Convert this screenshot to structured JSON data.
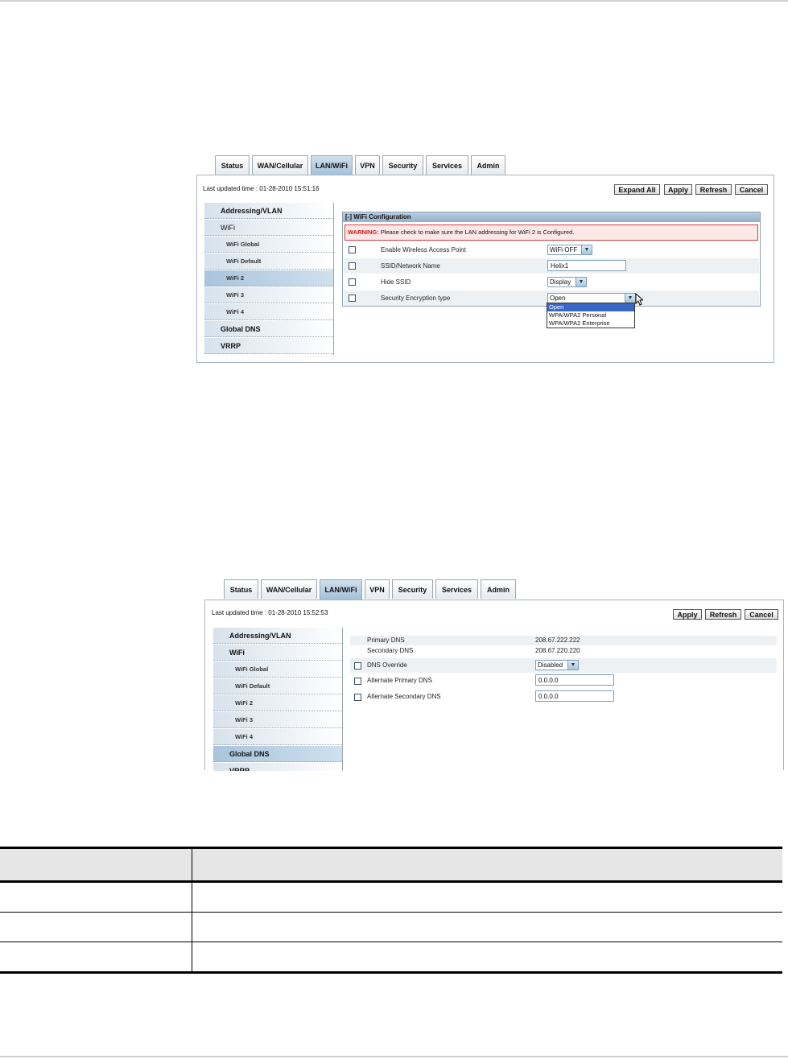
{
  "shot1": {
    "tabs": [
      "Status",
      "WAN/Cellular",
      "LAN/WiFi",
      "VPN",
      "Security",
      "Services",
      "Admin"
    ],
    "active_tab": "LAN/WiFi",
    "last_updated": "Last updated time : 01-28-2010 15:51:16",
    "buttons": {
      "expand_all": "Expand All",
      "apply": "Apply",
      "refresh": "Refresh",
      "cancel": "Cancel"
    },
    "sidebar": [
      "Addressing/VLAN",
      "WiFi",
      "WiFi Global",
      "WiFi Default",
      "WiFi 2",
      "WiFi 3",
      "WiFi 4",
      "Global DNS",
      "VRRP"
    ],
    "selected_item": "WiFi 2",
    "config_title": "[-] WiFi Configuration",
    "warning_label": "WARNING:",
    "warning_text": " Please check to make sure the LAN addressing for WiFi 2 is Configured.",
    "rows": {
      "enable_ap": {
        "label": "Enable Wireless Access Point",
        "value": "WiFi OFF"
      },
      "ssid": {
        "label": "SSID/Network Name",
        "value": "Helix1"
      },
      "hide_ssid": {
        "label": "Hide SSID",
        "value": "Display"
      },
      "encryption": {
        "label": "Security Encryption type",
        "value": "Open"
      }
    },
    "dropdown_options": [
      "Open",
      "WPA/WPA2 Personal",
      "WPA/WPA2 Enterprise"
    ],
    "dropdown_highlighted": "Open"
  },
  "shot2": {
    "tabs": [
      "Status",
      "WAN/Cellular",
      "LAN/WiFi",
      "VPN",
      "Security",
      "Services",
      "Admin"
    ],
    "active_tab": "LAN/WiFi",
    "last_updated": "Last updated time : 01-28-2010 15:52:53",
    "buttons": {
      "apply": "Apply",
      "refresh": "Refresh",
      "cancel": "Cancel"
    },
    "sidebar": [
      "Addressing/VLAN",
      "WiFi",
      "WiFi Global",
      "WiFi Default",
      "WiFi 2",
      "WiFi 3",
      "WiFi 4",
      "Global DNS",
      "VRRP"
    ],
    "selected_item": "Global DNS",
    "rows": {
      "primary_dns": {
        "label": "Primary DNS",
        "value": "208.67.222.222"
      },
      "secondary_dns": {
        "label": "Secondary DNS",
        "value": "208.67.220.220"
      },
      "dns_override": {
        "label": "DNS Override",
        "value": "Disabled"
      },
      "alt_primary": {
        "label": "Alternate Primary DNS",
        "value": "0.0.0.0"
      },
      "alt_secondary": {
        "label": "Alternate Secondary DNS",
        "value": "0.0.0.0"
      }
    }
  },
  "table": {
    "header": [
      "",
      ""
    ],
    "rows": [
      [
        "",
        ""
      ],
      [
        "",
        ""
      ],
      [
        "",
        ""
      ]
    ]
  }
}
